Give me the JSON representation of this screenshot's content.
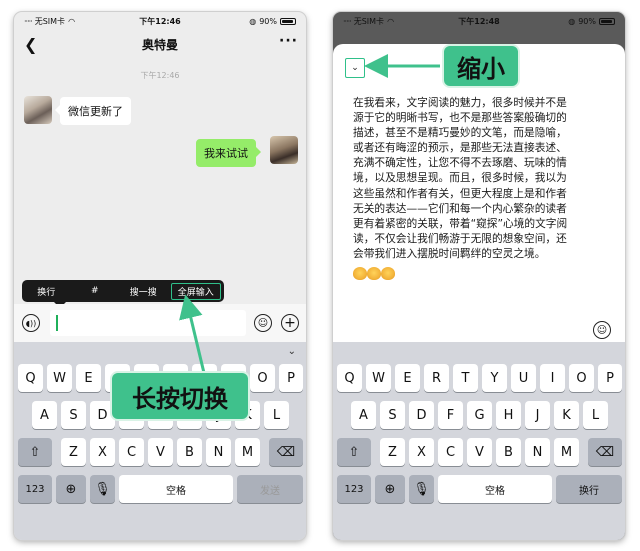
{
  "status": {
    "carrier": "无SIM卡",
    "battery": "90%",
    "time_left": "下午12:46",
    "time_right": "下午12:48"
  },
  "chat": {
    "title": "奥特曼",
    "timestamp": "下午12:46",
    "message_in": "微信更新了",
    "message_out": "我来试试"
  },
  "context_menu": {
    "items": [
      "换行",
      "#",
      "搜一搜",
      "全屏输入"
    ]
  },
  "keyboard": {
    "row1": [
      "Q",
      "W",
      "E",
      "R",
      "T",
      "Y",
      "U",
      "I",
      "O",
      "P"
    ],
    "row2": [
      "A",
      "S",
      "D",
      "F",
      "G",
      "H",
      "J",
      "K",
      "L"
    ],
    "row3": [
      "Z",
      "X",
      "C",
      "V",
      "B",
      "N",
      "M"
    ],
    "numbers_key": "123",
    "space_key": "空格",
    "send_key": "发送",
    "newline_key": "换行"
  },
  "fullscreen": {
    "lines": [
      "在我看来，文字阅读的魅力，很多时候并不是",
      "源于它的明晰书写，也不是那些答案般确切的",
      "描述，甚至不是精巧曼妙的文笔，而是隐喻，",
      "或者还有晦涩的预示，是那些无法直接表述、",
      "充满不确定性，让您不得不去琢磨、玩味的情",
      "境，以及思想呈现。而且，很多时候，我以为",
      "这些虽然和作者有关，但更大程度上是和作者",
      "无关的表达——它们和每一个内心繁杂的读者",
      "更有着紧密的关联，带着“窥探”心境的文字阅",
      "读，不仅会让我们畅游于无限的想象空间，还",
      "会带我们进入摆脱时间羁绊的空灵之境。"
    ]
  },
  "callouts": {
    "left": "长按切换",
    "right": "缩小"
  },
  "colors": {
    "accent": "#3fc18c",
    "bubble_out": "#95ec69",
    "keyboard_bg": "#d4d6dc"
  }
}
